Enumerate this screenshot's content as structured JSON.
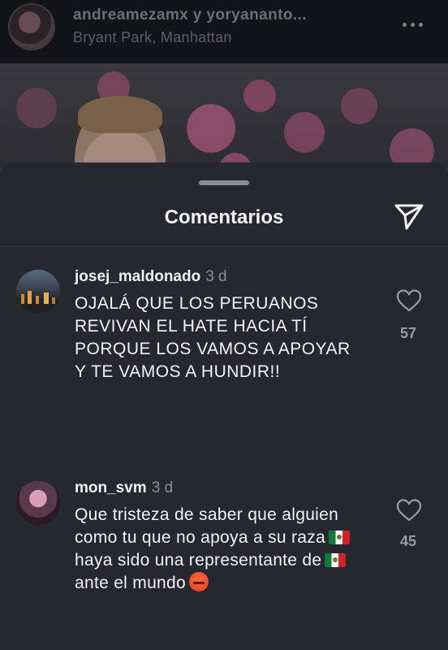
{
  "post": {
    "username": "andreamezamx y yoryananto...",
    "location": "Bryant Park, Manhattan"
  },
  "sheet": {
    "title": "Comentarios"
  },
  "comments": [
    {
      "username": "josej_maldonado",
      "time": "3 d",
      "text": "OJALÁ QUE LOS PERUANOS REVIVAN EL HATE HACIA TÍ PORQUE LOS VAMOS A APOYAR Y TE VAMOS A HUNDIR!!",
      "likes": "57"
    },
    {
      "username": "mon_svm",
      "time": "3 d",
      "text_parts": [
        "Que tristeza de saber que alguien como tu que no apoya a su raza",
        "haya sido una representante de",
        "ante el mundo"
      ],
      "likes": "45"
    }
  ],
  "icons": {
    "more": "more-horizontal-icon",
    "send": "send-icon",
    "heart": "heart-outline-icon"
  },
  "colors": {
    "sheet_bg": "#25282e",
    "text": "#f2f2f4",
    "muted": "#8d9096"
  }
}
